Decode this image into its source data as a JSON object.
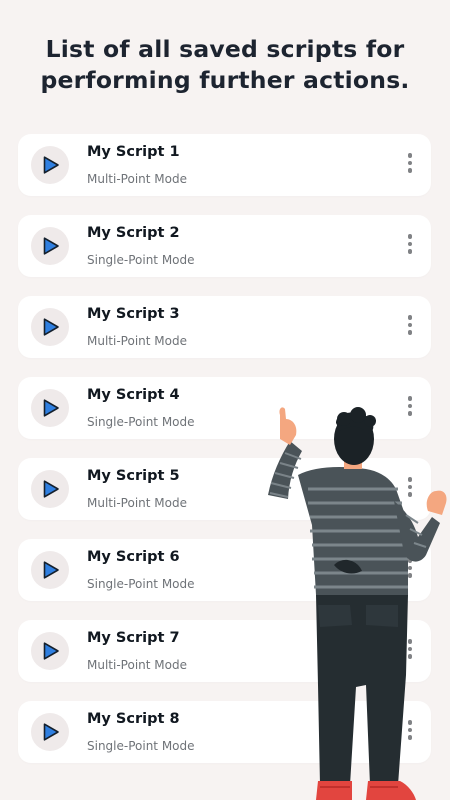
{
  "header": {
    "line1": "List of all saved scripts for",
    "line2": "performing further actions."
  },
  "scripts": [
    {
      "name": "My Script 1",
      "mode": "Multi-Point Mode"
    },
    {
      "name": "My Script 2",
      "mode": "Single-Point Mode"
    },
    {
      "name": "My Script 3",
      "mode": "Multi-Point Mode"
    },
    {
      "name": "My Script 4",
      "mode": "Single-Point Mode"
    },
    {
      "name": "My Script 5",
      "mode": "Multi-Point Mode"
    },
    {
      "name": "My Script 6",
      "mode": "Single-Point Mode"
    },
    {
      "name": "My Script 7",
      "mode": "Multi-Point Mode"
    },
    {
      "name": "My Script 8",
      "mode": "Single-Point Mode"
    }
  ],
  "icons": {
    "play": "play-icon",
    "menu": "more-vertical-icon"
  },
  "colors": {
    "background": "#f7f3f2",
    "card": "#ffffff",
    "play_accent": "#2f7fe0",
    "play_bg": "#efeaea",
    "title": "#1d2430"
  }
}
